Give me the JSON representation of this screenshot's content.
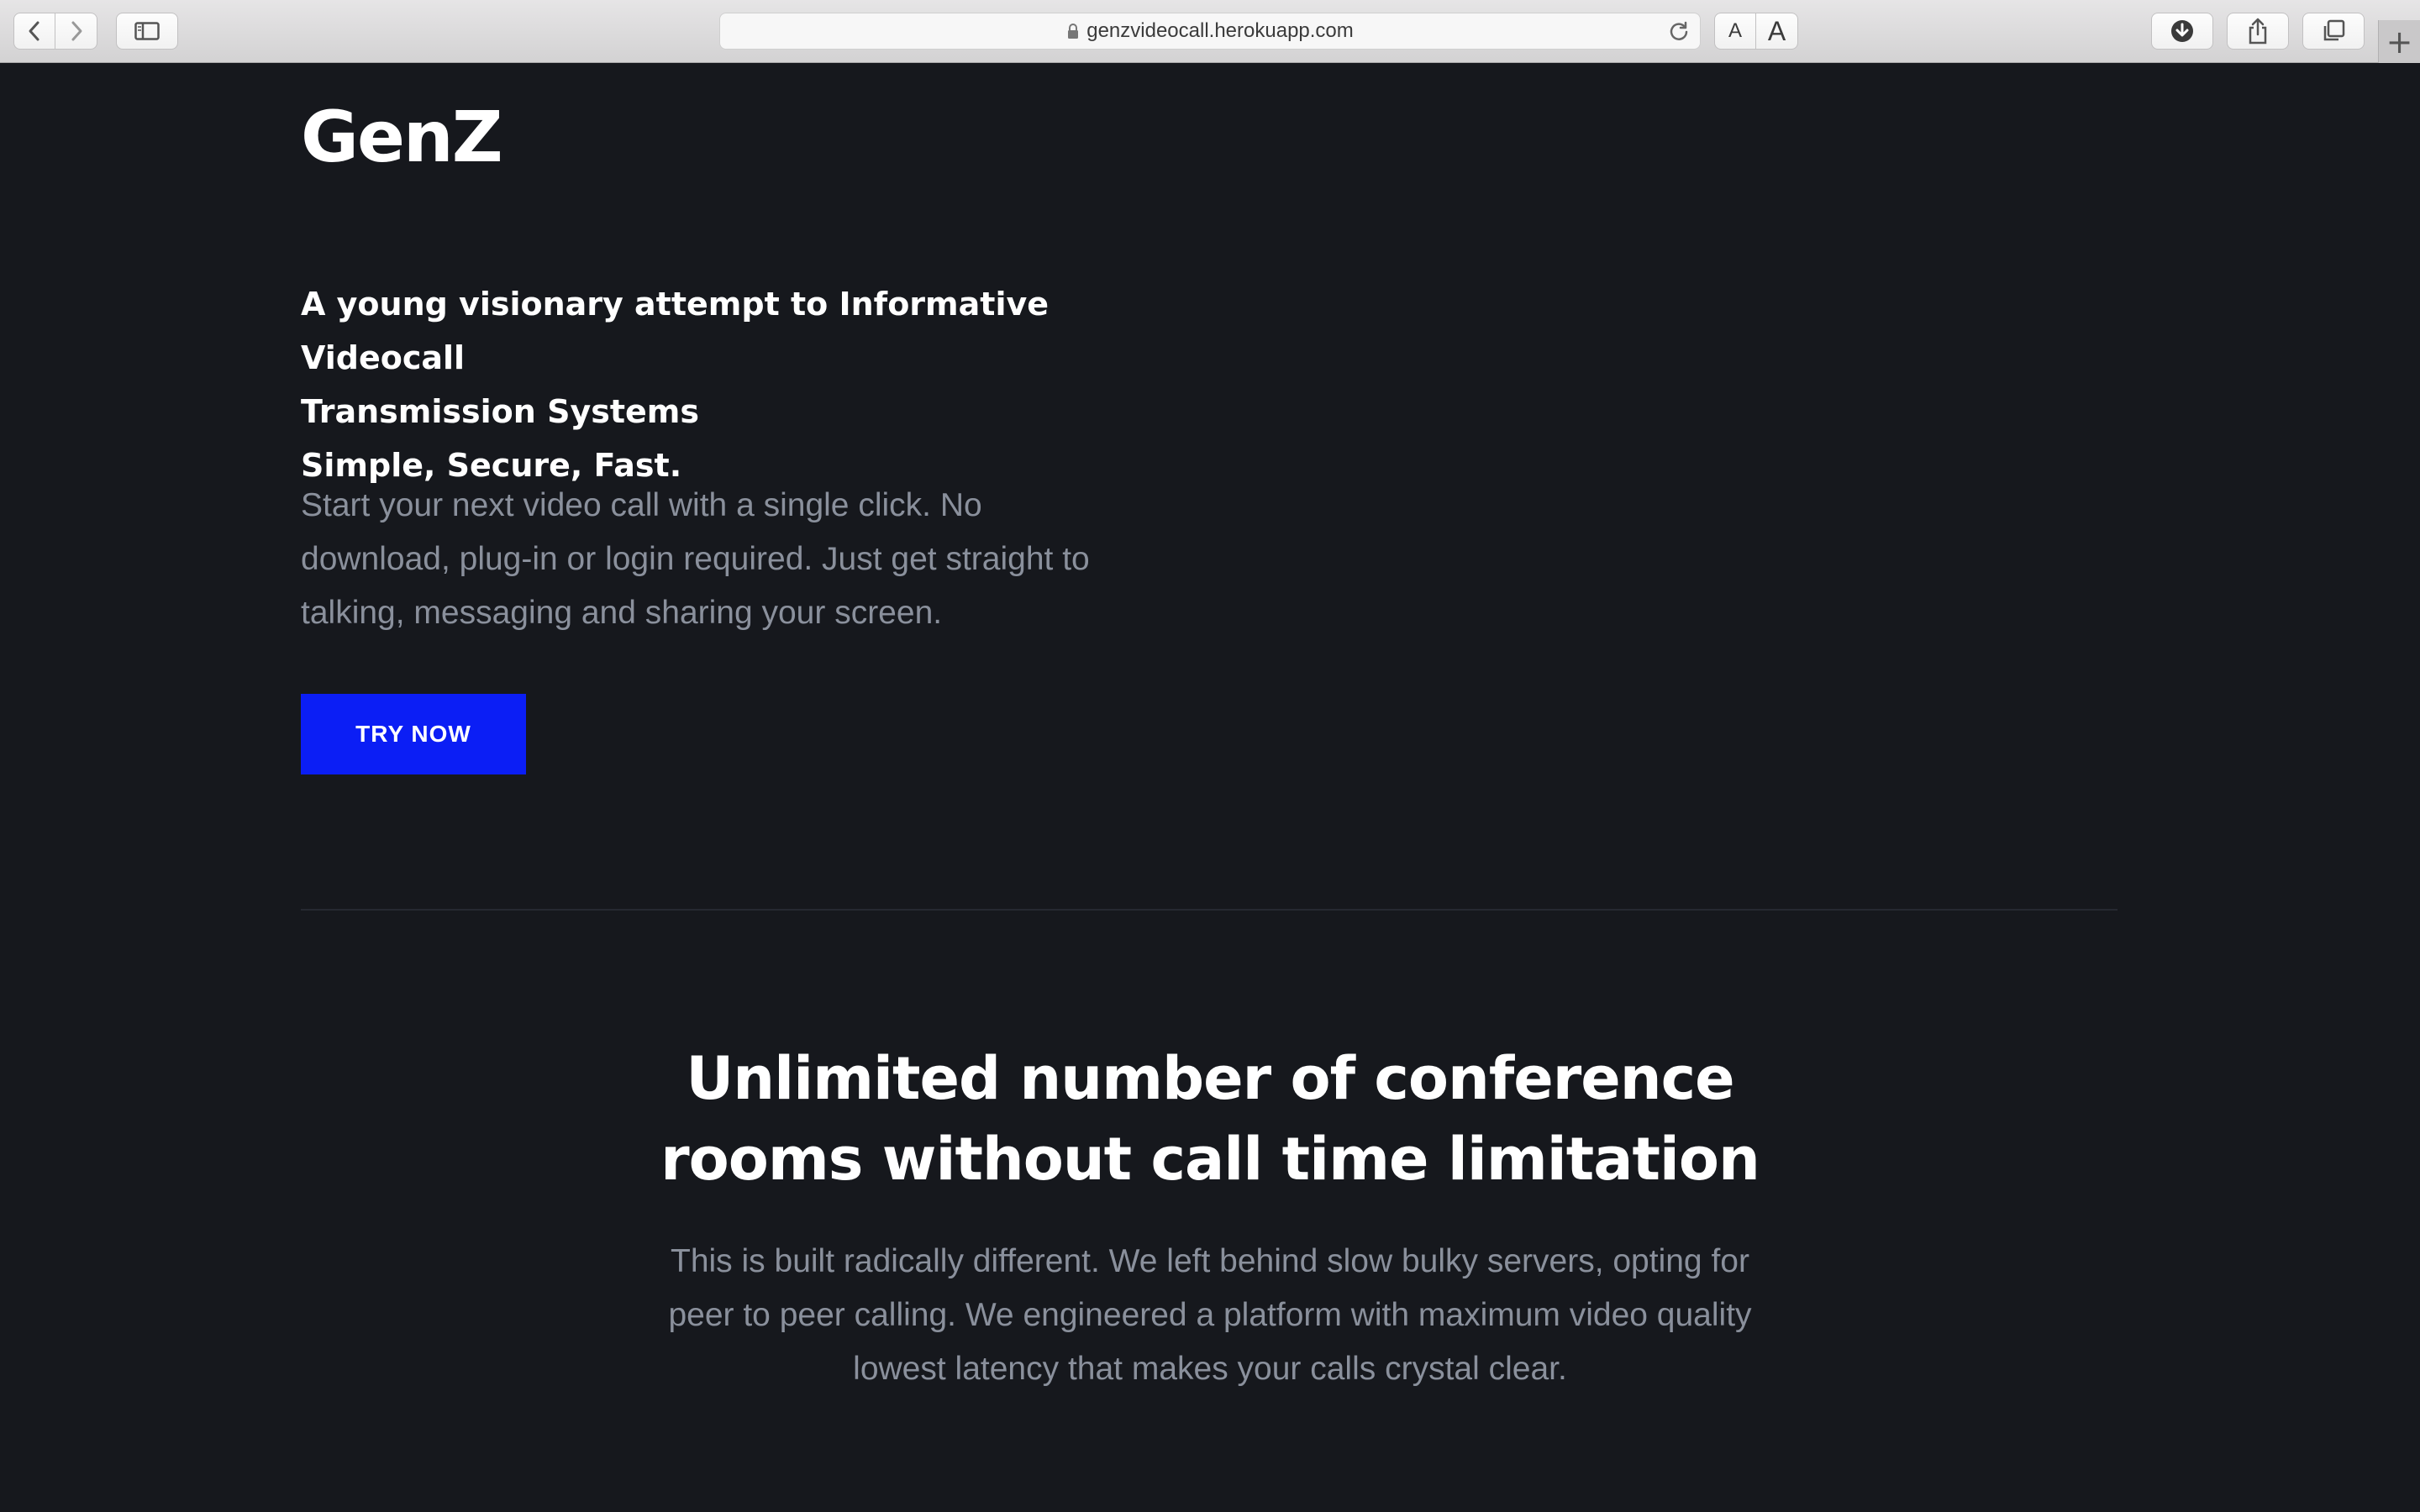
{
  "browser": {
    "url": "genzvideocall.herokuapp.com",
    "font_small_label": "A",
    "font_large_label": "A",
    "new_tab_label": "+"
  },
  "site": {
    "logo": "GenZ",
    "hero": {
      "headline_lines": [
        "A young visionary attempt to Informative Videocall",
        "Transmission Systems",
        "Simple, Secure, Fast."
      ],
      "description": "Start your next video call with a single click. No download, plug-in or login required. Just get straight to talking, messaging and sharing your screen.",
      "cta_label": "TRY NOW"
    },
    "feature": {
      "title_lines": [
        "Unlimited number of conference",
        "rooms without call time limitation"
      ],
      "text": "This is built radically different. We left behind slow bulky servers, opting for peer to peer calling. We engineered a platform with maximum video quality lowest latency that makes your calls crystal clear."
    }
  },
  "colors": {
    "page_background": "#16181d",
    "cta_background": "#0b1ef5",
    "body_text": "#8a909c",
    "heading_text": "#ffffff"
  },
  "icons": {
    "back": "chevron-left-icon",
    "forward": "chevron-right-icon",
    "sidebar": "sidebar-icon",
    "lock": "lock-icon",
    "reload": "reload-icon",
    "download": "download-icon",
    "share": "share-icon",
    "tabs": "tabs-icon"
  }
}
